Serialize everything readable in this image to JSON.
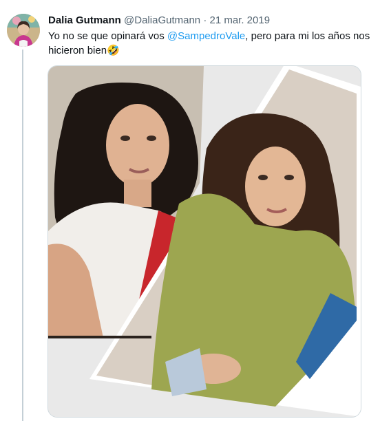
{
  "tweet": {
    "author_name": "Dalia Gutmann",
    "author_handle": "@DaliaGutmann",
    "separator": "·",
    "date": "21 mar. 2019",
    "text_before": "Yo no se que opinará vos ",
    "mention": "@SampedroVale",
    "text_after": ", pero para mi los años nos hicieron bien",
    "emoji": "🤣"
  },
  "colors": {
    "text": "#0f1419",
    "secondary": "#536471",
    "link": "#1d9bf0",
    "border": "#cfd9de"
  },
  "icons": {
    "avatar": "profile-photo",
    "media": "photo-collage-two-portraits"
  }
}
